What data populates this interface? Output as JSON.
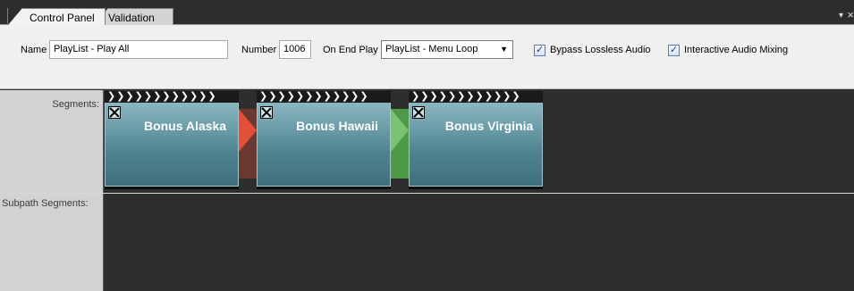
{
  "tabs": [
    {
      "label": "Control Panel"
    },
    {
      "label": "Validation"
    }
  ],
  "window_controls": {
    "menu_glyph": "▾",
    "close_glyph": "×"
  },
  "props": {
    "name_label": "Name",
    "name_value": "PlayList - Play All",
    "number_label": "Number",
    "number_value": "1006",
    "on_end_label": "On End Play",
    "on_end_value": "PlayList - Menu Loop",
    "bypass_label": "Bypass Lossless Audio",
    "bypass_checked": true,
    "interactive_label": "Interactive Audio Mixing",
    "interactive_checked": true
  },
  "tracks": {
    "segments_label": "Segments:",
    "subpath_label": "Subpath Segments:"
  },
  "clips": [
    {
      "header": "❯❯❯❯❯❯❯❯❯❯❯❯",
      "title": "Bonus Alaska"
    },
    {
      "header": "❯❯❯❯❯❯❯❯❯❯❯❯",
      "title": "Bonus Hawaii"
    },
    {
      "header": "❯❯❯❯❯❯❯❯❯❯❯❯",
      "title": "Bonus Virginia"
    }
  ],
  "transitions": [
    {
      "color": "#e8543a"
    },
    {
      "color": "#5fae57"
    }
  ],
  "colors": {
    "accent_red": "#e8543a",
    "accent_green": "#5fae57",
    "clip_teal": "#4f8390"
  }
}
